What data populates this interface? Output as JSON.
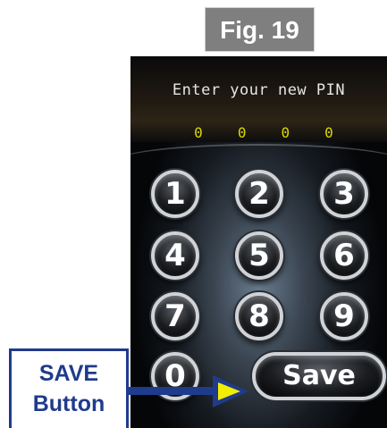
{
  "figure": {
    "label": "Fig. 19"
  },
  "screen": {
    "prompt": "Enter your new PIN",
    "pin_digits": [
      "0",
      "0",
      "0",
      "0"
    ],
    "keypad": [
      "1",
      "2",
      "3",
      "4",
      "5",
      "6",
      "7",
      "8",
      "9",
      "0"
    ],
    "save_label": "Save"
  },
  "callout": {
    "line1": "SAVE",
    "line2": "Button"
  },
  "colors": {
    "pin_digit": "#d8d800",
    "callout_blue": "#1f3b8c",
    "arrow_fill": "#f2ee00",
    "fig_label_bg": "#7f7f7f"
  }
}
